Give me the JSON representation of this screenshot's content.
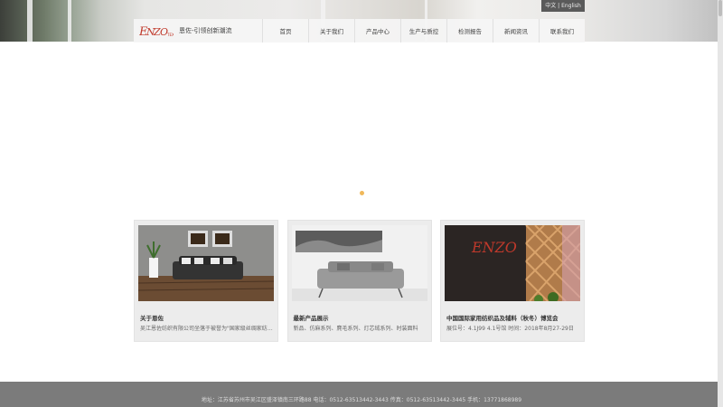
{
  "header": {
    "lang_cn": "中文",
    "lang_sep": "|",
    "lang_en": "English",
    "tagline": "恩佐-引领创新潮流",
    "logo_text": "ENZO TEX"
  },
  "nav": {
    "items": [
      {
        "label": "首页"
      },
      {
        "label": "关于我们"
      },
      {
        "label": "产品中心"
      },
      {
        "label": "生产与质控"
      },
      {
        "label": "检测报告"
      },
      {
        "label": "新闻资讯"
      },
      {
        "label": "联系我们"
      }
    ]
  },
  "cards": [
    {
      "title": "关于恩佐",
      "desc": "吴江恩佐纺织有限公司坐落于被誉为\"国家级丝绸家纺...\""
    },
    {
      "title": "最新产品展示",
      "desc": "新品、仿麻系列、麂毛系列、灯芯绒系列、时装面料"
    },
    {
      "title": "中国国际家用纺织品及辅料（秋冬）博览会",
      "desc": "展位号：4.1J99 4.1号馆 时间：2018年8月27-29日"
    }
  ],
  "footer": {
    "address": "地址：江苏省苏州市吴江区盛泽镇南三环路88 电话：0512-63513442-3443 传真：0512-63513442-3445 手机：13771868989"
  },
  "colors": {
    "accent_dot": "#f0b85a",
    "footer_bg": "#7b7b7b",
    "logo_red": "#c0392b"
  }
}
